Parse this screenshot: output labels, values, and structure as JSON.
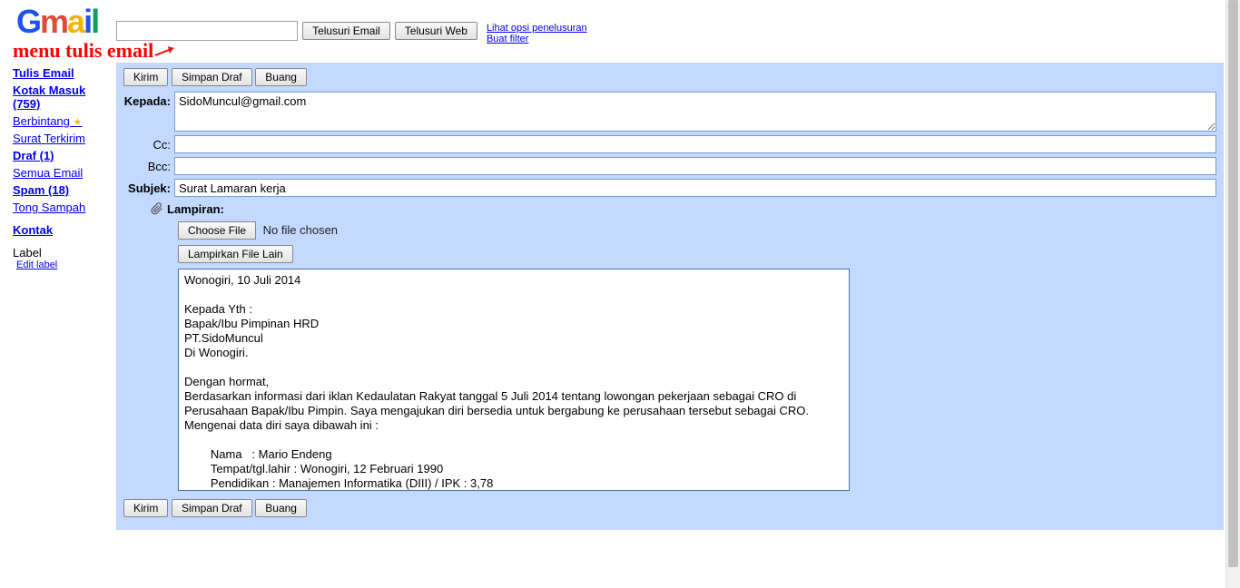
{
  "header": {
    "search_email_btn": "Telusuri Email",
    "search_web_btn": "Telusuri Web",
    "link_search_options": "Lihat opsi penelusuran",
    "link_create_filter": "Buat filter"
  },
  "annotation": "menu tulis email",
  "sidebar": {
    "compose": "Tulis Email",
    "inbox": "Kotak Masuk (759)",
    "starred": "Berbintang",
    "sent": "Surat Terkirim",
    "drafts": "Draf (1)",
    "all": "Semua Email",
    "spam": "Spam (18)",
    "trash": "Tong Sampah",
    "contacts": "Kontak",
    "label_head": "Label",
    "edit_label": "Edit label"
  },
  "compose": {
    "send_btn": "Kirim",
    "save_draft_btn": "Simpan Draf",
    "discard_btn": "Buang",
    "to_label": "Kepada:",
    "to_value": "SidoMuncul@gmail.com",
    "cc_label": "Cc:",
    "cc_value": "",
    "bcc_label": "Bcc:",
    "bcc_value": "",
    "subject_label": "Subjek:",
    "subject_value": "Surat Lamaran kerja",
    "attach_label": "Lampiran:",
    "choose_file_btn": "Choose File",
    "no_file": "No file chosen",
    "attach_another_btn": "Lampirkan File Lain",
    "body": "Wonogiri, 10 Juli 2014\n\nKepada Yth :\nBapak/Ibu Pimpinan HRD\nPT.SidoMuncul\nDi Wonogiri.\n\nDengan hormat,\nBerdasarkan informasi dari iklan Kedaulatan Rakyat tanggal 5 Juli 2014 tentang lowongan pekerjaan sebagai CRO di Perusahaan Bapak/Ibu Pimpin. Saya mengajukan diri bersedia untuk bergabung ke perusahaan tersebut sebagai CRO.\nMengenai data diri saya dibawah ini :\n\n        Nama   : Mario Endeng\n        Tempat/tgl.lahir : Wonogiri, 12 Februari 1990\n        Pendidikan : Manajemen Informatika (DIII) / IPK : 3,78"
  }
}
